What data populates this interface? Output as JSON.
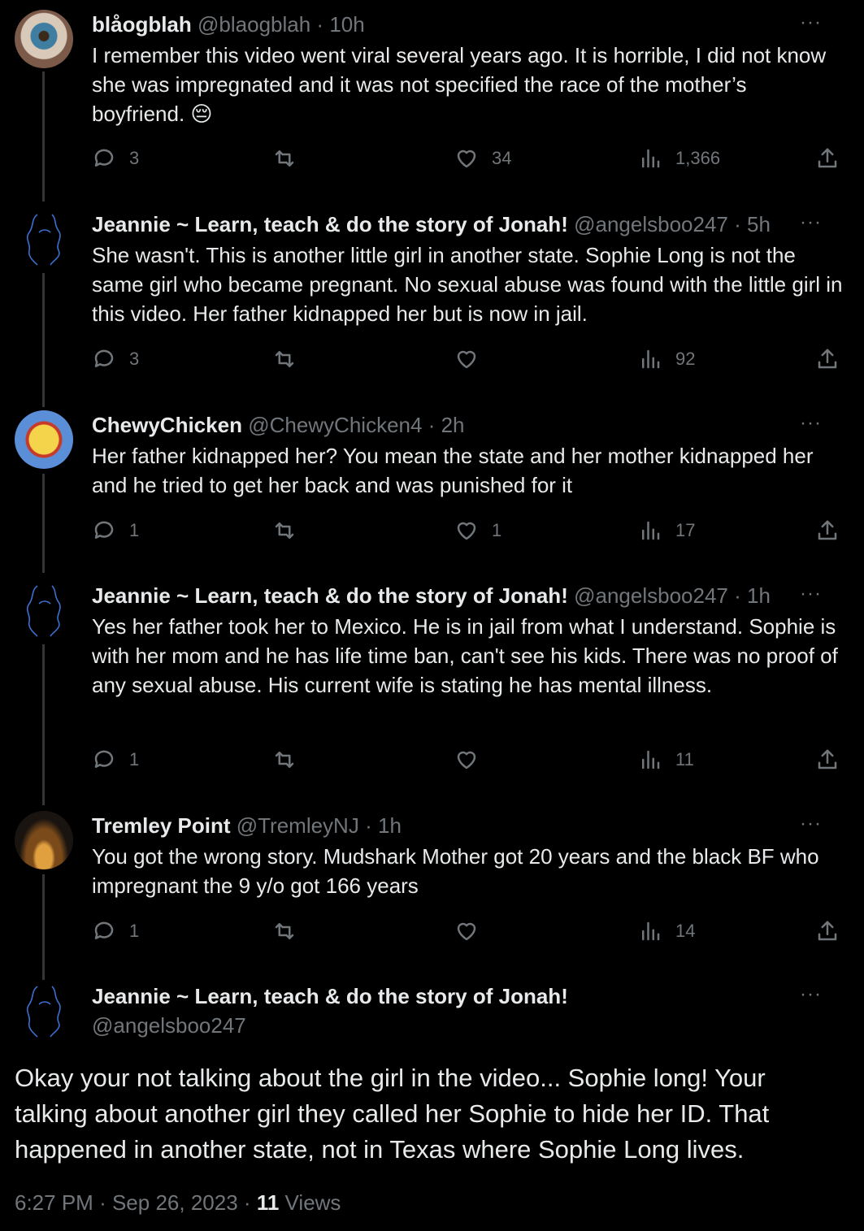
{
  "icons": {
    "reply": "reply-icon",
    "retweet": "retweet-icon",
    "like": "heart-icon",
    "views": "views-icon",
    "share": "share-icon",
    "more": "more-icon"
  },
  "tweets": [
    {
      "name": "blåogblah",
      "handle": "@blaogblah",
      "sep": "·",
      "time": "10h",
      "text": "I remember this video went viral several years ago. It is horrible, I did not know she was impregnated and it was not specified the race of the mother’s boyfriend. 😔",
      "replies": "3",
      "retweets": "",
      "likes": "34",
      "views": "1,366"
    },
    {
      "name": "Jeannie ~ Learn, teach & do the story of Jonah!",
      "handle": "@angelsboo247",
      "sep": "·",
      "time": "5h",
      "text": "She wasn't. This is another little girl in another state. Sophie Long is not the same girl who became pregnant. No sexual abuse was found with the little girl in this video. Her father kidnapped her but is now in jail.",
      "replies": "3",
      "retweets": "",
      "likes": "",
      "views": "92"
    },
    {
      "name": "ChewyChicken",
      "handle": "@ChewyChicken4",
      "sep": "·",
      "time": "2h",
      "text": "Her father kidnapped her? You mean the state and her mother kidnapped her and he tried to get her back and was punished for it",
      "replies": "1",
      "retweets": "",
      "likes": "1",
      "views": "17"
    },
    {
      "name": "Jeannie ~ Learn, teach & do the story of Jonah!",
      "handle": "@angelsboo247",
      "sep": "·",
      "time": "1h",
      "text": "Yes her father took her to Mexico. He is in jail from what I understand. Sophie is with her mom and he has life time ban, can't see his kids. There was no proof of any sexual abuse. His current wife is stating he has mental illness.",
      "replies": "1",
      "retweets": "",
      "likes": "",
      "views": "11"
    },
    {
      "name": "Tremley Point",
      "handle": "@TremleyNJ",
      "sep": "·",
      "time": "1h",
      "text": "You got the wrong story. Mudshark Mother got 20 years and the black BF who impregnant the 9 y/o got 166 years",
      "replies": "1",
      "retweets": "",
      "likes": "",
      "views": "14"
    }
  ],
  "main": {
    "name": "Jeannie ~ Learn, teach & do the story of Jonah!",
    "handle": "@angelsboo247",
    "text": "Okay your not talking about the girl in the video... Sophie long! Your talking about another girl they called her Sophie to hide her ID. That happened in another state, not in Texas where Sophie Long lives.",
    "time": "6:27 PM",
    "sep1": "·",
    "date": "Sep 26, 2023",
    "sep2": "·",
    "views_count": "11",
    "views_label": "Views"
  },
  "more_label": "···"
}
